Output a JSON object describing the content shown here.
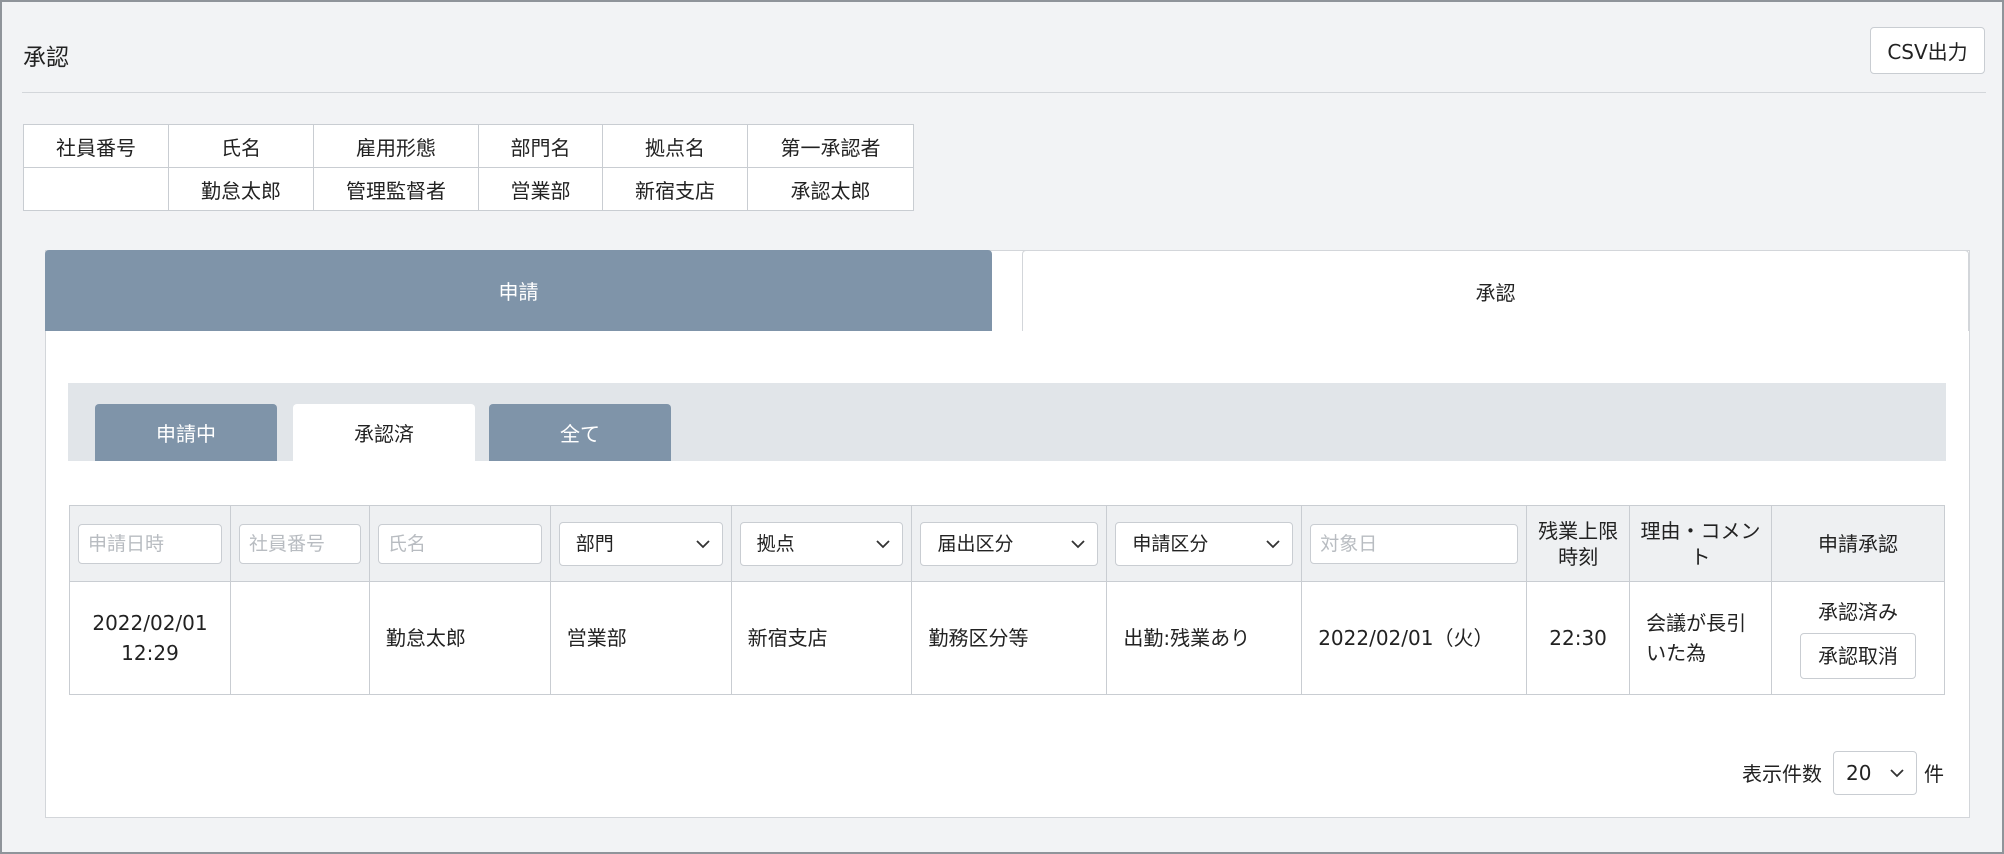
{
  "page": {
    "title": "承認",
    "csv_button": "CSV出力"
  },
  "employee_info": {
    "headers": [
      "社員番号",
      "氏名",
      "雇用形態",
      "部門名",
      "拠点名",
      "第一承認者"
    ],
    "values": [
      "",
      "勤怠太郎",
      "管理監督者",
      "営業部",
      "新宿支店",
      "承認太郎"
    ]
  },
  "main_tabs": {
    "apply": "申請",
    "approve": "承認"
  },
  "sub_tabs": {
    "pending": "申請中",
    "approved": "承認済",
    "all": "全て"
  },
  "filters": {
    "date_placeholder": "申請日時",
    "emp_no_placeholder": "社員番号",
    "name_placeholder": "氏名",
    "dept_select": "部門",
    "site_select": "拠点",
    "notice_type_select": "届出区分",
    "apply_type_select": "申請区分",
    "target_date_placeholder": "対象日",
    "overtime_header": "残業上限時刻",
    "reason_header": "理由・コメント",
    "action_header": "申請承認"
  },
  "rows": [
    {
      "date": "2022/02/01",
      "time": "12:29",
      "emp_no": "",
      "name": "勤怠太郎",
      "dept": "営業部",
      "site": "新宿支店",
      "notice_type": "勤務区分等",
      "apply_type": "出勤:残業あり",
      "target_date": "2022/02/01（火）",
      "overtime_limit": "22:30",
      "reason": "会議が長引いた為",
      "status": "承認済み",
      "cancel_label": "承認取消"
    }
  ],
  "pagination": {
    "label": "表示件数",
    "value": "20",
    "unit": "件"
  },
  "colors": {
    "tab_dark": "#7f94a9",
    "link": "#3a8fd8",
    "background": "#f2f3f5"
  }
}
